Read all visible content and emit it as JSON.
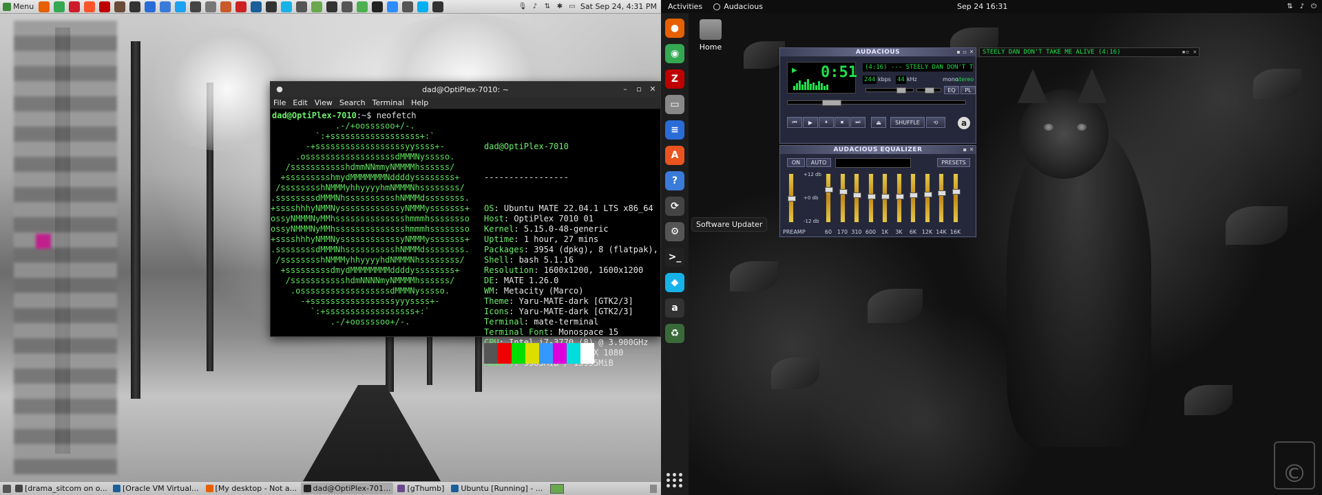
{
  "mate": {
    "top_panel": {
      "menu_label": "Menu",
      "launchers": [
        {
          "icon": "firefox-icon",
          "color": "#e66000"
        },
        {
          "icon": "chrome-icon",
          "color": "#34a853"
        },
        {
          "icon": "opera-icon",
          "color": "#cc1b2b"
        },
        {
          "icon": "brave-icon",
          "color": "#fb542b"
        },
        {
          "icon": "filezilla-icon",
          "color": "#bf0000"
        },
        {
          "icon": "coffee-icon",
          "color": "#6a4a3a"
        },
        {
          "icon": "system-monitor-icon",
          "color": "#333333"
        },
        {
          "icon": "writer-icon",
          "color": "#2a6cd6"
        },
        {
          "icon": "mail-icon",
          "color": "#3a7ad8"
        },
        {
          "icon": "twitter-icon",
          "color": "#1da1f2"
        },
        {
          "icon": "screenshot-icon",
          "color": "#444444"
        },
        {
          "icon": "calculator-icon",
          "color": "#777777"
        },
        {
          "icon": "calendar-icon",
          "color": "#c85a2a"
        },
        {
          "icon": "help-icon",
          "color": "#cc2222"
        },
        {
          "icon": "virtualbox-icon",
          "color": "#1a5e9a"
        },
        {
          "icon": "keyboard-icon",
          "color": "#333333"
        },
        {
          "icon": "kodi-icon",
          "color": "#17b2e7"
        },
        {
          "icon": "settings-icon",
          "color": "#555555"
        },
        {
          "icon": "photos-icon",
          "color": "#6aa84f"
        },
        {
          "icon": "appstore-icon",
          "color": "#333333"
        },
        {
          "icon": "updater-icon",
          "color": "#555555"
        },
        {
          "icon": "refresh-icon",
          "color": "#4caf50"
        },
        {
          "icon": "terminal-icon",
          "color": "#222222"
        },
        {
          "icon": "zoom-icon",
          "color": "#2d8cff"
        },
        {
          "icon": "meet-icon",
          "color": "#555555"
        },
        {
          "icon": "skype-icon",
          "color": "#00aff0"
        },
        {
          "icon": "world-icon",
          "color": "#333333"
        }
      ],
      "clock": "Sat Sep 24,  4:31 PM"
    },
    "bottom_panel": {
      "tasks": [
        {
          "label": "[drama_sitcom on o...",
          "color": "#444444",
          "active": false
        },
        {
          "label": "[Oracle VM Virtual...",
          "color": "#1a5e9a",
          "active": false
        },
        {
          "label": "[My desktop - Not a...",
          "color": "#e66000",
          "active": false
        },
        {
          "label": "dad@OptiPlex-701...",
          "color": "#222222",
          "active": true
        },
        {
          "label": "[gThumb]",
          "color": "#6a4a8a",
          "active": false
        },
        {
          "label": "Ubuntu [Running] - ...",
          "color": "#1a5e9a",
          "active": false
        }
      ]
    },
    "terminal": {
      "title": "dad@OptiPlex-7010: ~",
      "menu": [
        "File",
        "Edit",
        "View",
        "Search",
        "Terminal",
        "Help"
      ],
      "prompt_user": "dad@OptiPlex-7010",
      "prompt_rest": ":~$ neofetch",
      "ascii": "             .-/+oossssoo+/-.\n         `:+ssssssssssssssssss+:`\n       -+ssssssssssssssssssyyssss+-\n     .ossssssssssssssssssdMMMNysssso.\n   /ssssssssssshdmmNNmmyNMMMMhssssss/\n  +ssssssssshmydMMMMMMMNddddyssssssss+\n /sssssssshNMMMyhhyyyyhmNMMMNhssssssss/\n.ssssssssdMMMNhsssssssssshNMMMdssssssss.\n+sssshhhyNMMNyssssssssssssyNMMMysssssss+\nossyNMMMNyMMhsssssssssssssshmmmhssssssso\nossyNMMMNyMMhsssssssssssssshmmmhssssssso\n+sssshhhyNMMNyssssssssssssyNMMMysssssss+\n.ssssssssdMMMNhsssssssssshNMMMdssssssss.\n /sssssssshNMMMyhhyyyyhdNMMMNhssssssss/\n  +sssssssssdmydMMMMMMMMddddyssssssss+\n   /ssssssssssshdmNNNNmyNMMMMhssssss/\n    .ossssssssssssssssssdMMMNysssso.\n      -+sssssssssssssssssyyyssss+-\n        `:+ssssssssssssssssss+:`\n            .-/+oossssoo+/-.",
      "info_header": "dad@OptiPlex-7010",
      "info_sep": "-----------------",
      "info": [
        {
          "k": "OS",
          "v": "Ubuntu MATE 22.04.1 LTS x86_64"
        },
        {
          "k": "Host",
          "v": "OptiPlex 7010 01"
        },
        {
          "k": "Kernel",
          "v": "5.15.0-48-generic"
        },
        {
          "k": "Uptime",
          "v": "1 hour, 27 mins"
        },
        {
          "k": "Packages",
          "v": "3954 (dpkg), 8 (flatpak),"
        },
        {
          "k": "Shell",
          "v": "bash 5.1.16"
        },
        {
          "k": "Resolution",
          "v": "1600x1200, 1600x1200"
        },
        {
          "k": "DE",
          "v": "MATE 1.26.0"
        },
        {
          "k": "WM",
          "v": "Metacity (Marco)"
        },
        {
          "k": "Theme",
          "v": "Yaru-MATE-dark [GTK2/3]"
        },
        {
          "k": "Icons",
          "v": "Yaru-MATE-dark [GTK2/3]"
        },
        {
          "k": "Terminal",
          "v": "mate-terminal"
        },
        {
          "k": "Terminal Font",
          "v": "Monospace 15"
        },
        {
          "k": "CPU",
          "v": "Intel i7-3770 (8) @ 3.900GHz"
        },
        {
          "k": "GPU",
          "v": "NVIDIA GeForce GTX 1080"
        },
        {
          "k": "Memory",
          "v": "9585MiB / 15955MiB"
        }
      ],
      "swatches": [
        "#555555",
        "#ee0000",
        "#00dd00",
        "#dddd00",
        "#3399ff",
        "#dd00dd",
        "#00dddd",
        "#ffffff"
      ]
    }
  },
  "gnome": {
    "top_bar": {
      "activities": "Activities",
      "app_name": "Audacious",
      "clock": "Sep 24  16:31"
    },
    "dock": [
      {
        "icon": "firefox-icon",
        "color": "#e66000",
        "glyph": "●"
      },
      {
        "icon": "chrome-icon",
        "color": "#34a853",
        "glyph": "◉"
      },
      {
        "icon": "filezilla-icon",
        "color": "#bf0000",
        "glyph": "Z"
      },
      {
        "icon": "files-icon",
        "color": "#888888",
        "glyph": "▭"
      },
      {
        "icon": "writer-icon",
        "color": "#2a6cd6",
        "glyph": "≡"
      },
      {
        "icon": "appcenter-icon",
        "color": "#e95420",
        "glyph": "A"
      },
      {
        "icon": "help-icon",
        "color": "#3a7ad8",
        "glyph": "?"
      },
      {
        "icon": "updater-icon",
        "color": "#444444",
        "glyph": "⟳"
      },
      {
        "icon": "settings-icon",
        "color": "#555555",
        "glyph": "⚙"
      },
      {
        "icon": "terminal-icon",
        "color": "#222222",
        "glyph": ">_"
      },
      {
        "icon": "kodi-icon",
        "color": "#17b2e7",
        "glyph": "◆"
      },
      {
        "icon": "audacious-icon",
        "color": "#333333",
        "glyph": "a"
      },
      {
        "icon": "trash-icon",
        "color": "#3a6a3a",
        "glyph": "♻"
      }
    ],
    "home_label": "Home",
    "tooltip": "Software Updater",
    "audacious": {
      "title": "AUDACIOUS",
      "time": "0:51",
      "song": "(4:16) --- STEELY DAN   DON'T T",
      "bitrate": "244",
      "bitrate_unit": "kbps",
      "samplerate": "44",
      "samplerate_unit": "kHz",
      "channels": "mono",
      "stereo": "stereo",
      "shuffle": "SHUFFLE",
      "playlist_text": "STEELY DAN   DON'T TAKE ME ALIVE  (4:16)",
      "equalizer_title": "AUDACIOUS EQUALIZER",
      "eq_on": "ON",
      "eq_auto": "AUTO",
      "eq_presets": "PRESETS",
      "eq_db_top": "+12 db",
      "eq_db_mid": "+0 db",
      "eq_db_bot": "-12 db",
      "eq_bands": [
        "PREAMP",
        "60",
        "170",
        "310",
        "600",
        "1K",
        "3K",
        "6K",
        "12K",
        "14K",
        "16K"
      ],
      "eq_levels": [
        0.5,
        0.3,
        0.35,
        0.42,
        0.45,
        0.45,
        0.45,
        0.42,
        0.4,
        0.38,
        0.35
      ]
    }
  }
}
